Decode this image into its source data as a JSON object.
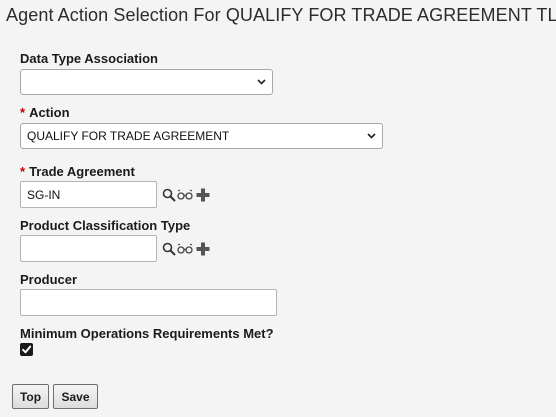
{
  "page": {
    "title": "Agent Action Selection For QUALIFY FOR TRADE AGREEMENT TL"
  },
  "fields": {
    "data_type_association": {
      "label": "Data Type Association",
      "value": ""
    },
    "action": {
      "required_marker": "*",
      "label": "Action",
      "value": "QUALIFY FOR TRADE AGREEMENT"
    },
    "trade_agreement": {
      "required_marker": "*",
      "label": "Trade Agreement",
      "value": "SG-IN"
    },
    "product_classification_type": {
      "label": "Product Classification Type",
      "value": ""
    },
    "producer": {
      "label": "Producer",
      "value": ""
    },
    "minimum_operations": {
      "label": "Minimum Operations Requirements Met?",
      "checked": true
    }
  },
  "buttons": {
    "top_label": "Top",
    "save_label": "Save"
  },
  "icons": {
    "lookup": "search-icon",
    "view": "glasses-icon",
    "add": "plus-icon",
    "dropdown": "chevron-down-icon",
    "check": "checkmark-icon"
  },
  "colors": {
    "required": "#c40000",
    "background": "#f4f4f4"
  }
}
